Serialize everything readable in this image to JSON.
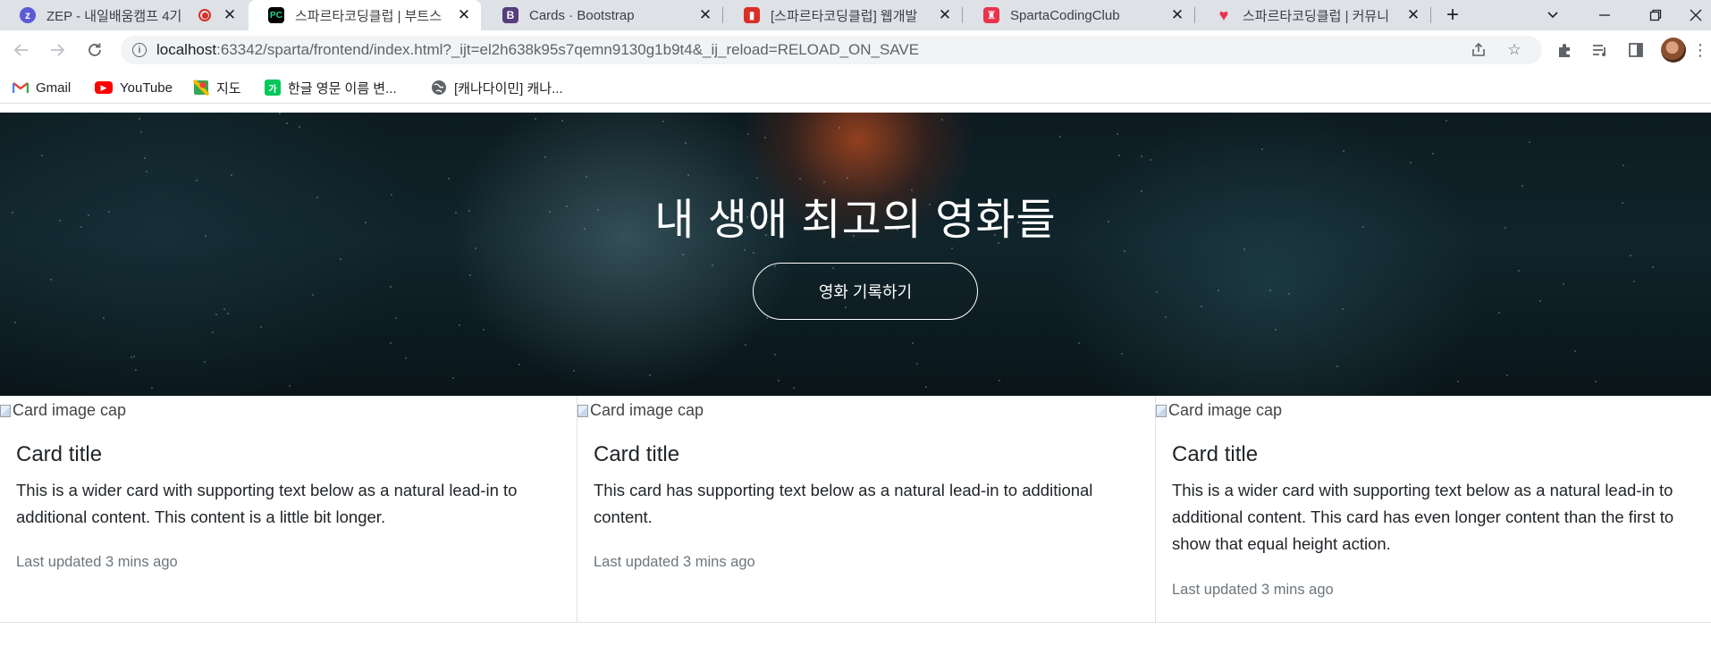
{
  "browser": {
    "tabs": [
      {
        "title": "ZEP - 내일배움캠프 4기",
        "favicon": "zep-icon",
        "favicon_color": "#5b5bd6",
        "active": false,
        "recording": true
      },
      {
        "title": "스파르타코딩클럽 | 부트스",
        "favicon": "pycharm-icon",
        "favicon_color": "#21d789",
        "active": true
      },
      {
        "title": "Cards · Bootstrap",
        "favicon": "bootstrap-icon",
        "favicon_color": "#563d7c",
        "active": false
      },
      {
        "title": "[스파르타코딩클럽] 웹개발",
        "favicon": "book-icon",
        "favicon_color": "#d93025",
        "active": false
      },
      {
        "title": "SpartaCodingClub",
        "favicon": "sparta-icon",
        "favicon_color": "#e8344e",
        "active": false
      },
      {
        "title": "스파르타코딩클럽 | 커뮤니",
        "favicon": "heart-icon",
        "favicon_color": "#e8344e",
        "active": false
      }
    ],
    "address": {
      "host": "localhost",
      "path": ":63342/sparta/frontend/index.html?_ijt=el2h638k95s7qemn9130g1b9t4&_ij_reload=RELOAD_ON_SAVE"
    },
    "bookmarks": [
      {
        "label": "Gmail",
        "icon": "gmail-icon"
      },
      {
        "label": "YouTube",
        "icon": "youtube-icon"
      },
      {
        "label": "지도",
        "icon": "maps-icon"
      },
      {
        "label": "한글 영문 이름 변...",
        "icon": "naver-dictionary-icon"
      },
      {
        "label": "[캐나다이민] 캐나...",
        "icon": "globe-icon"
      }
    ]
  },
  "page": {
    "hero": {
      "title": "내 생애 최고의 영화들",
      "button_label": "영화 기록하기"
    },
    "cards": [
      {
        "img_alt": "Card image cap",
        "title": "Card title",
        "text": "This is a wider card with supporting text below as a natural lead-in to additional content. This content is a little bit longer.",
        "footer": "Last updated 3 mins ago"
      },
      {
        "img_alt": "Card image cap",
        "title": "Card title",
        "text": "This card has supporting text below as a natural lead-in to additional content.",
        "footer": "Last updated 3 mins ago"
      },
      {
        "img_alt": "Card image cap",
        "title": "Card title",
        "text": "This is a wider card with supporting text below as a natural lead-in to additional content. This card has even longer content than the first to show that equal height action.",
        "footer": "Last updated 3 mins ago"
      }
    ]
  }
}
